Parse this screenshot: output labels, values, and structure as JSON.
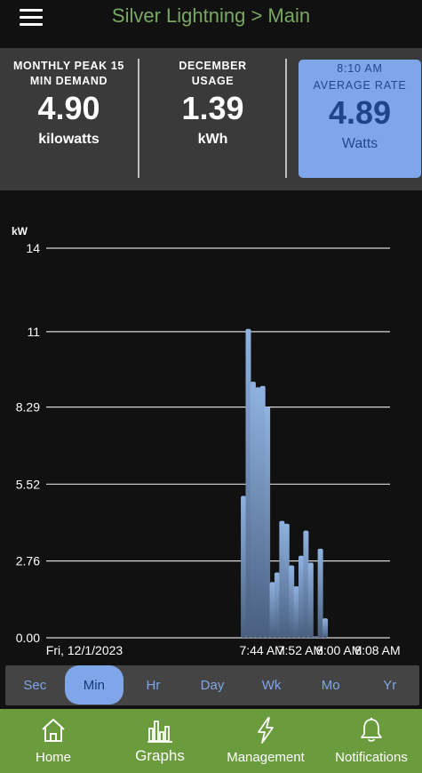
{
  "header": {
    "title": "Silver Lightning > Main"
  },
  "summary": {
    "peak": {
      "label_line1": "MONTHLY PEAK 15",
      "label_line2": "MIN DEMAND",
      "value": "4.90",
      "unit": "kilowatts"
    },
    "usage": {
      "label_line1": "DECEMBER",
      "label_line2": "USAGE",
      "value": "1.39",
      "unit": "kWh"
    },
    "rate": {
      "label_line1": "8:10 AM",
      "label_line2": "AVERAGE RATE",
      "value": "4.89",
      "unit": "Watts"
    }
  },
  "chart_data": {
    "type": "bar",
    "ylabel": "kW",
    "yticks": [
      "14",
      "11",
      "8.29",
      "5.52",
      "2.76",
      "0.00"
    ],
    "ylim": [
      0,
      14
    ],
    "xticks": [
      "Fri, 12/1/2023",
      "7:44 AM",
      "7:52 AM",
      "8:00 AM",
      "8:08 AM"
    ],
    "x_minutes": [
      0,
      37,
      45,
      53,
      61
    ],
    "grid": true,
    "bar_color": "#8fb2e0",
    "bars": [
      {
        "minute": 33.1,
        "value": 5.1
      },
      {
        "minute": 34.1,
        "value": 11.1
      },
      {
        "minute": 35.1,
        "value": 9.2
      },
      {
        "minute": 36.1,
        "value": 9.0
      },
      {
        "minute": 37.1,
        "value": 9.05
      },
      {
        "minute": 38.1,
        "value": 8.3
      },
      {
        "minute": 39.1,
        "value": 2.0
      },
      {
        "minute": 40.1,
        "value": 2.35
      },
      {
        "minute": 41.1,
        "value": 4.2
      },
      {
        "minute": 42.1,
        "value": 4.1
      },
      {
        "minute": 43.1,
        "value": 2.6
      },
      {
        "minute": 44.1,
        "value": 1.85
      },
      {
        "minute": 45.1,
        "value": 2.95
      },
      {
        "minute": 46.1,
        "value": 3.85
      },
      {
        "minute": 47.1,
        "value": 2.7
      },
      {
        "minute": 48.1,
        "value": 0.05
      },
      {
        "minute": 49.1,
        "value": 3.2
      },
      {
        "minute": 50.1,
        "value": 0.7
      }
    ]
  },
  "tabs": [
    "Sec",
    "Min",
    "Hr",
    "Day",
    "Wk",
    "Mo",
    "Yr"
  ],
  "active_tab": "Min",
  "nav": {
    "home": "Home",
    "graphs": "Graphs",
    "management": "Management",
    "notifications": "Notifications"
  }
}
